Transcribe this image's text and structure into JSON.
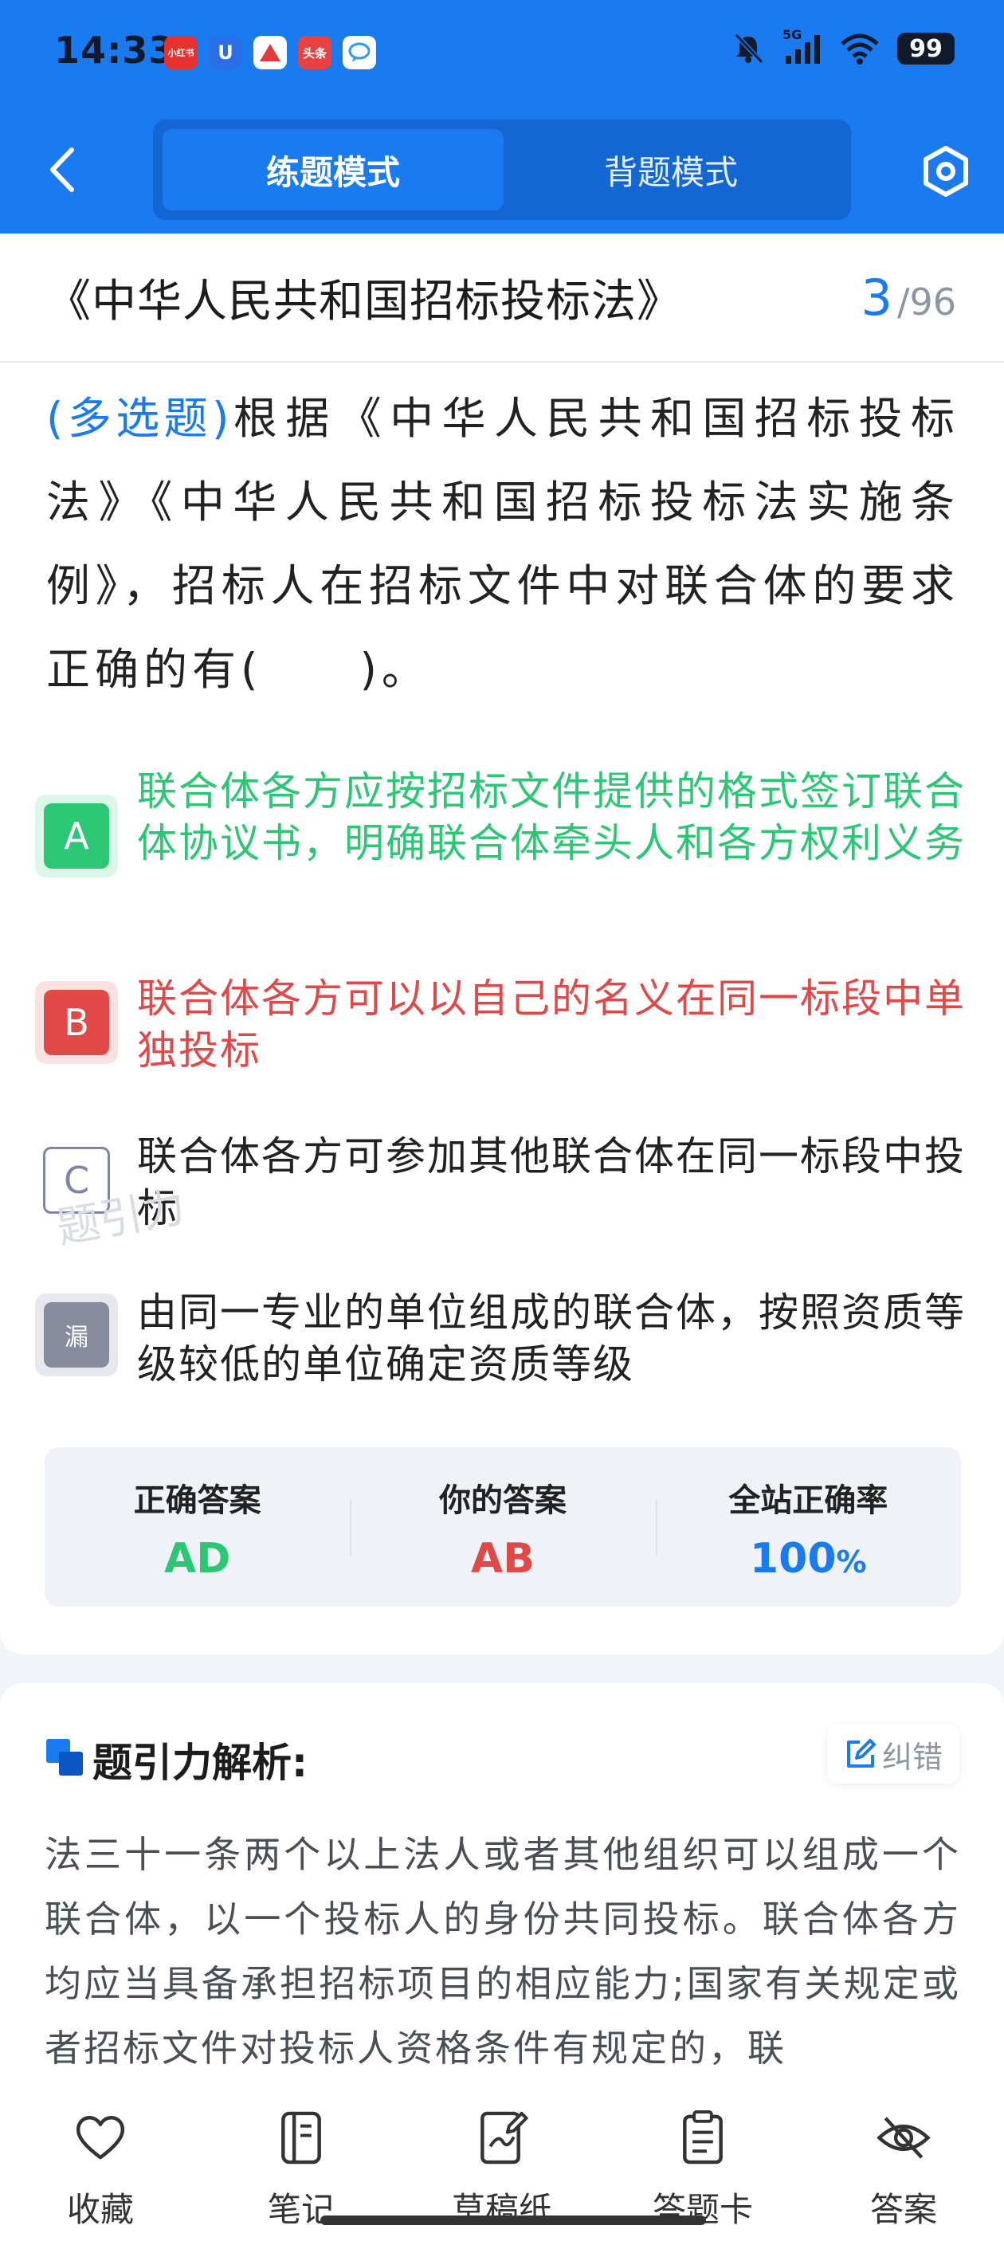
{
  "status_bar": {
    "time": "14:33",
    "app_icons": [
      {
        "name": "xiaohongshu-icon",
        "label": "小红书",
        "color": "#e6322e"
      },
      {
        "name": "shield-app-icon",
        "label": "U",
        "color": "#2a6ee8"
      },
      {
        "name": "red-app-icon",
        "label": "",
        "color": "#e33b3b"
      },
      {
        "name": "toutiao-icon",
        "label": "头条",
        "color": "#e84141"
      },
      {
        "name": "chat-app-icon",
        "label": "",
        "color": "#2e9bf0"
      }
    ],
    "battery": "99",
    "network": "5G"
  },
  "nav": {
    "tab_practice": "练题模式",
    "tab_memorize": "背题模式"
  },
  "header": {
    "law_title": "《中华人民共和国招标投标法》",
    "current": "3",
    "separator": "/",
    "total": "96"
  },
  "question": {
    "type": "(多选题)",
    "text": "根据《中华人民共和国招标投标法》《中华人民共和国招标投标法实施条例》，招标人在招标文件中对联合体的要求正确的有(　　)。"
  },
  "options": [
    {
      "key": "A",
      "text": "联合体各方应按招标文件提供的格式签订联合体协议书，明确联合体牵头人和各方权利义务",
      "state": "correct"
    },
    {
      "key": "B",
      "text": "联合体各方可以以自己的名义在同一标段中单独投标",
      "state": "wrong"
    },
    {
      "key": "C",
      "text": "联合体各方可参加其他联合体在同一标段中投标",
      "state": "normal"
    },
    {
      "key": "漏",
      "text": "由同一专业的单位组成的联合体，按照资质等级较低的单位确定资质等级",
      "state": "missed"
    }
  ],
  "watermark": "题引力",
  "answers": {
    "correct_label": "正确答案",
    "correct_value": "AD",
    "yours_label": "你的答案",
    "yours_value": "AB",
    "rate_label": "全站正确率",
    "rate_value": "100",
    "rate_unit": "%"
  },
  "analysis": {
    "title": "题引力解析:",
    "report_label": "纠错",
    "text": "法三十一条两个以上法人或者其他组织可以组成一个联合体，以一个投标人的身份共同投标。联合体各方均应当具备承担招标项目的相应能力;国家有关规定或者招标文件对投标人资格条件有规定的，联"
  },
  "bottom_bar": [
    {
      "label": "收藏",
      "icon": "heart-icon"
    },
    {
      "label": "笔记",
      "icon": "notebook-icon"
    },
    {
      "label": "草稿纸",
      "icon": "draft-icon"
    },
    {
      "label": "答题卡",
      "icon": "clipboard-icon"
    },
    {
      "label": "答案",
      "icon": "eye-off-icon"
    }
  ],
  "colors": {
    "primary": "#1a7bf0",
    "correct": "#2cc774",
    "wrong": "#e14848",
    "missed": "#868c9e"
  }
}
